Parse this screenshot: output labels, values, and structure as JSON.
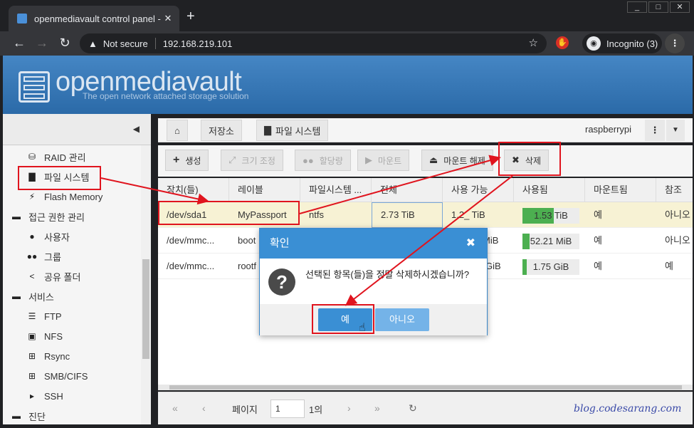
{
  "browser": {
    "tab_title": "openmediavault control panel - r",
    "tab_close": "✕",
    "new_tab": "+",
    "window_buttons": [
      "_",
      "□",
      "✕"
    ],
    "security_label": "Not secure",
    "url": "192.168.219.101",
    "profile_label": "Incognito (3)"
  },
  "omv": {
    "brand": "openmediavault",
    "tagline": "The open network attached storage solution"
  },
  "sidebar": {
    "collapse_icon": "◀",
    "items": [
      {
        "label": "RAID 관리",
        "icon": "database-icon"
      },
      {
        "label": "파일 시스템",
        "icon": "folder-icon"
      },
      {
        "label": "Flash Memory",
        "icon": "bolt-icon"
      },
      {
        "label": "접근 권한 관리",
        "icon": "minus-square-icon"
      },
      {
        "label": "사용자",
        "icon": "user-icon"
      },
      {
        "label": "그룹",
        "icon": "users-icon"
      },
      {
        "label": "공유 폴더",
        "icon": "share-icon"
      },
      {
        "label": "서비스",
        "icon": "minus-square-icon"
      },
      {
        "label": "FTP",
        "icon": "server-icon"
      },
      {
        "label": "NFS",
        "icon": "desktop-icon"
      },
      {
        "label": "Rsync",
        "icon": "sitemap-icon"
      },
      {
        "label": "SMB/CIFS",
        "icon": "windows-icon"
      },
      {
        "label": "SSH",
        "icon": "terminal-icon"
      },
      {
        "label": "진단",
        "icon": "minus-square-icon"
      }
    ]
  },
  "breadcrumb": {
    "items": [
      "저장소",
      "파일 시스템"
    ],
    "user": "raspberrypi"
  },
  "toolbar": {
    "create": "생성",
    "resize": "크기 조정",
    "quota": "할당량",
    "mount": "마운트",
    "unmount": "마운트 해제",
    "delete": "삭제"
  },
  "grid": {
    "columns": [
      "장치(들)",
      "레이블",
      "파일시스템 ...",
      "전체",
      "사용 가능",
      "사용됨",
      "마운트됨",
      "참조"
    ],
    "rows": [
      {
        "device": "/dev/sda1",
        "label": "MyPassport",
        "fs": "ntfs",
        "total": "2.73 TiB",
        "avail": "1.2_ TiB",
        "used": "1.53 TiB",
        "used_pct": 55,
        "mounted": "예",
        "ref": "아니오"
      },
      {
        "device": "/dev/mmc...",
        "label": "boot",
        "fs": "",
        "total": "",
        "avail": "MiB",
        "used": "52.21 MiB",
        "used_pct": 12,
        "mounted": "예",
        "ref": "아니오"
      },
      {
        "device": "/dev/mmc...",
        "label": "rootf",
        "fs": "",
        "total": "",
        "avail": "GiB",
        "used": "1.75 GiB",
        "used_pct": 8,
        "mounted": "예",
        "ref": "예"
      }
    ]
  },
  "pager": {
    "page_label": "페이지",
    "page_value": "1",
    "of_label": "1의"
  },
  "dialog": {
    "title": "확인",
    "close": "✖",
    "message": "선택된 항목(들)을 정말 삭제하시겠습니까?",
    "yes": "예",
    "no": "아니오"
  },
  "watermark": "blog.codesarang.com",
  "colors": {
    "header_blue": "#3a8fd4",
    "annotation_red": "#e0141e",
    "usage_green": "#4caf50"
  }
}
